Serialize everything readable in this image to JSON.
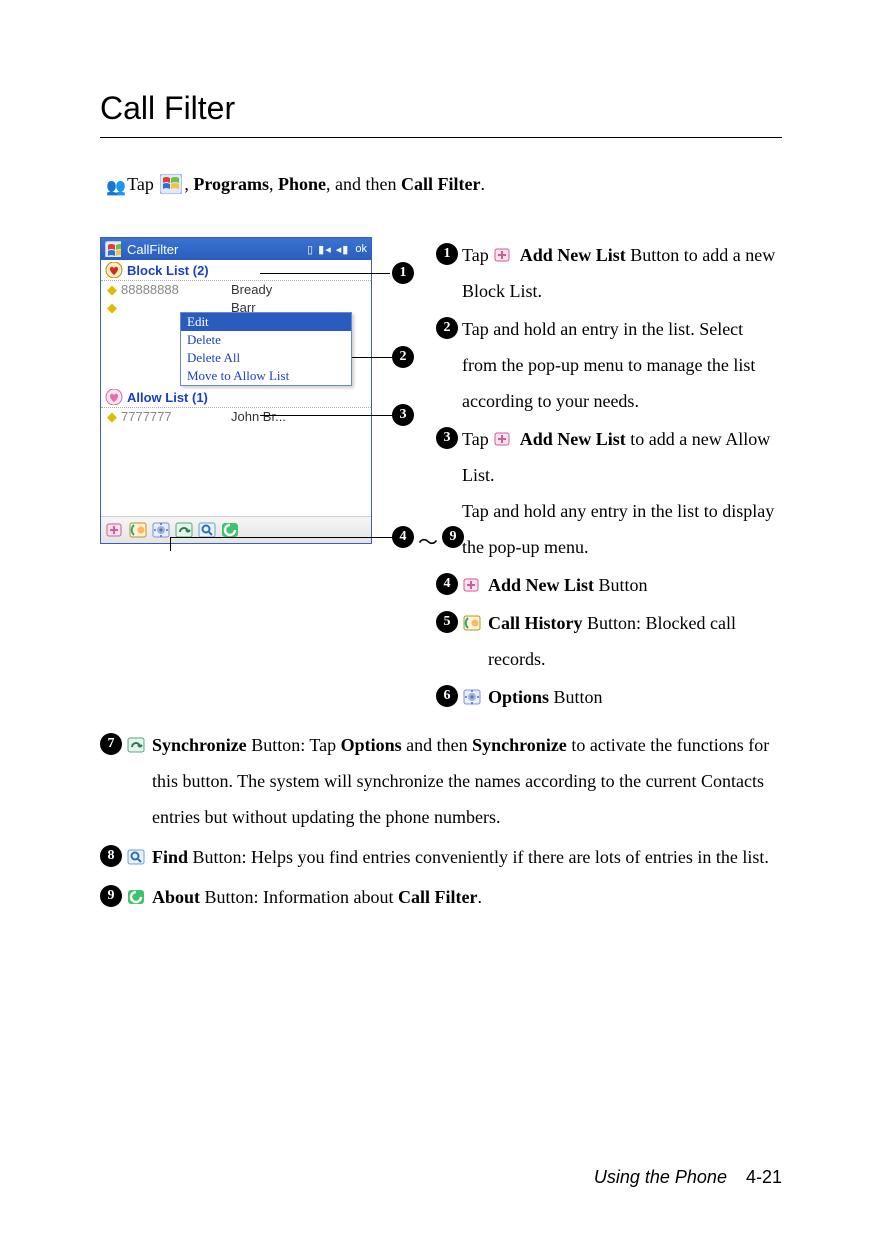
{
  "title": "Call Filter",
  "intro": {
    "lead": " Tap ",
    "after_icon": ", ",
    "programs": "Programs",
    "sep1": ", ",
    "phone": "Phone",
    "sep2": ", and then ",
    "callfilter": "Call Filter",
    "end": "."
  },
  "mock": {
    "app_title": "CallFilter",
    "status": "ok",
    "block_list_label": "Block List (2)",
    "block_rows": [
      {
        "num": "88888888",
        "name": "Bready"
      },
      {
        "num": "",
        "name": "Barr"
      }
    ],
    "popup": [
      "Edit",
      "Delete",
      "Delete All",
      "Move to Allow List"
    ],
    "allow_list_label": "Allow List (1)",
    "allow_rows": [
      {
        "num": "7777777",
        "name": "John Br..."
      }
    ],
    "toolbar_icons": [
      "add-new-list-icon",
      "call-history-icon",
      "options-icon",
      "synchronize-icon",
      "find-icon",
      "about-icon"
    ]
  },
  "callouts": {
    "c1": "1",
    "c2": "2",
    "c3": "3",
    "c4": "4",
    "tilde": "～",
    "c9": "9"
  },
  "items": {
    "i1": {
      "p1": "Tap ",
      "bold": "Add New List",
      "p2": " Button to add a new Block List."
    },
    "i2": {
      "p1": "Tap and hold an entry in the list. Select from the pop-up menu to manage the list according to your needs."
    },
    "i3": {
      "p1": "Tap ",
      "bold": "Add New List",
      "p2": " to add a new Allow List.",
      "p3": "Tap and hold any entry in the list to display the pop-up menu."
    },
    "i4": {
      "bold": "Add New List",
      "p1": " Button"
    },
    "i5": {
      "bold": "Call History",
      "p1": " Button: Blocked call records."
    },
    "i6": {
      "bold": "Options",
      "p1": " Button"
    },
    "i7": {
      "bold": "Synchronize",
      "p1": " Button: Tap ",
      "bold2": "Options",
      "p2": " and then ",
      "bold3": "Synchronize",
      "p3": " to activate the functions for this button. The system will synchronize the names according to the current Contacts entries but without updating the phone numbers."
    },
    "i8": {
      "bold": "Find",
      "p1": " Button: Helps you find entries conveniently if there are lots of entries in the list."
    },
    "i9": {
      "bold": "About",
      "p1": " Button: Information about ",
      "bold2": "Call Filter",
      "p2": "."
    }
  },
  "numbers": {
    "n1": "1",
    "n2": "2",
    "n3": "3",
    "n4": "4",
    "n5": "5",
    "n6": "6",
    "n7": "7",
    "n8": "8",
    "n9": "9"
  },
  "footer": {
    "section": "Using the Phone",
    "page": "4-21"
  }
}
